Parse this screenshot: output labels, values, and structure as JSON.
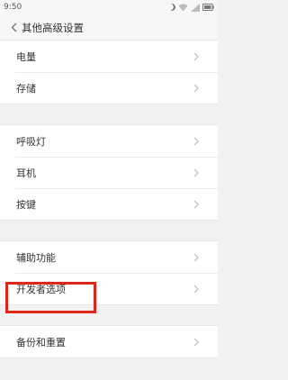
{
  "status_bar": {
    "time": "9:50",
    "icons": [
      "moon-icon",
      "wifi-icon",
      "signal-icon",
      "battery-icon"
    ]
  },
  "header": {
    "title": "其他高级设置"
  },
  "groups": [
    {
      "items": [
        {
          "label": "电量"
        },
        {
          "label": "存储"
        }
      ]
    },
    {
      "items": [
        {
          "label": "呼吸灯"
        },
        {
          "label": "耳机"
        },
        {
          "label": "按键"
        }
      ]
    },
    {
      "items": [
        {
          "label": "辅助功能"
        },
        {
          "label": "开发者选项",
          "highlighted": true
        }
      ]
    },
    {
      "items": [
        {
          "label": "备份和重置"
        }
      ]
    }
  ],
  "colors": {
    "highlight": "#e0261b",
    "background": "#f2f2f2",
    "row": "#ffffff"
  }
}
